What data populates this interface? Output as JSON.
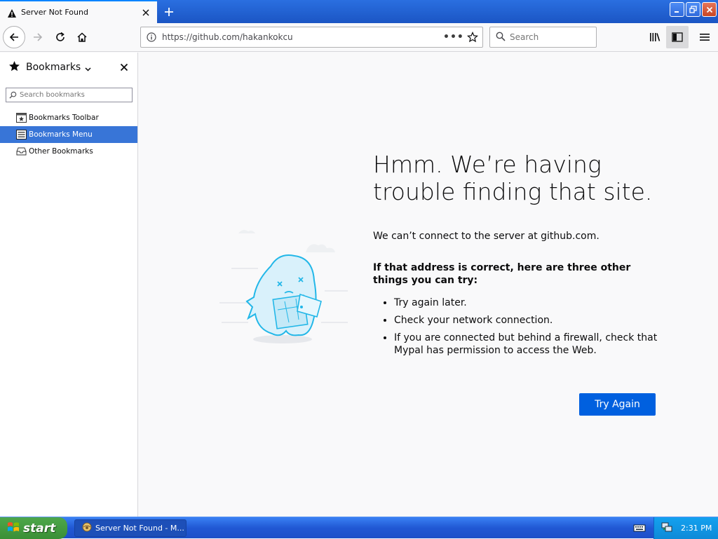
{
  "tab": {
    "title": "Server Not Found"
  },
  "navbar": {
    "url": "https://github.com/hakankokcu",
    "page_actions": "•••",
    "search_placeholder": "Search"
  },
  "sidebar": {
    "title": "Bookmarks",
    "search_placeholder": "Search bookmarks",
    "items": [
      {
        "label": "Bookmarks Toolbar",
        "icon": "bookmarks-toolbar-icon"
      },
      {
        "label": "Bookmarks Menu",
        "icon": "bookmarks-menu-icon",
        "selected": true
      },
      {
        "label": "Other Bookmarks",
        "icon": "other-bookmarks-icon"
      }
    ]
  },
  "error": {
    "title": "Hmm. We’re having trouble finding that site.",
    "description": "We can’t connect to the server at github.com.",
    "subheading": "If that address is correct, here are three other things you can try:",
    "suggestions": [
      "Try again later.",
      "Check your network connection.",
      "If you are connected but behind a firewall, check that Mypal has permission to access the Web."
    ],
    "button": "Try Again"
  },
  "taskbar": {
    "start_label": "start",
    "task_item": "Server Not Found - M...",
    "clock": "2:31 PM"
  },
  "colors": {
    "accent": "#0060df",
    "selection": "#3875d7",
    "xp_blue": "#2158d4",
    "start_green": "#3a8f36"
  }
}
